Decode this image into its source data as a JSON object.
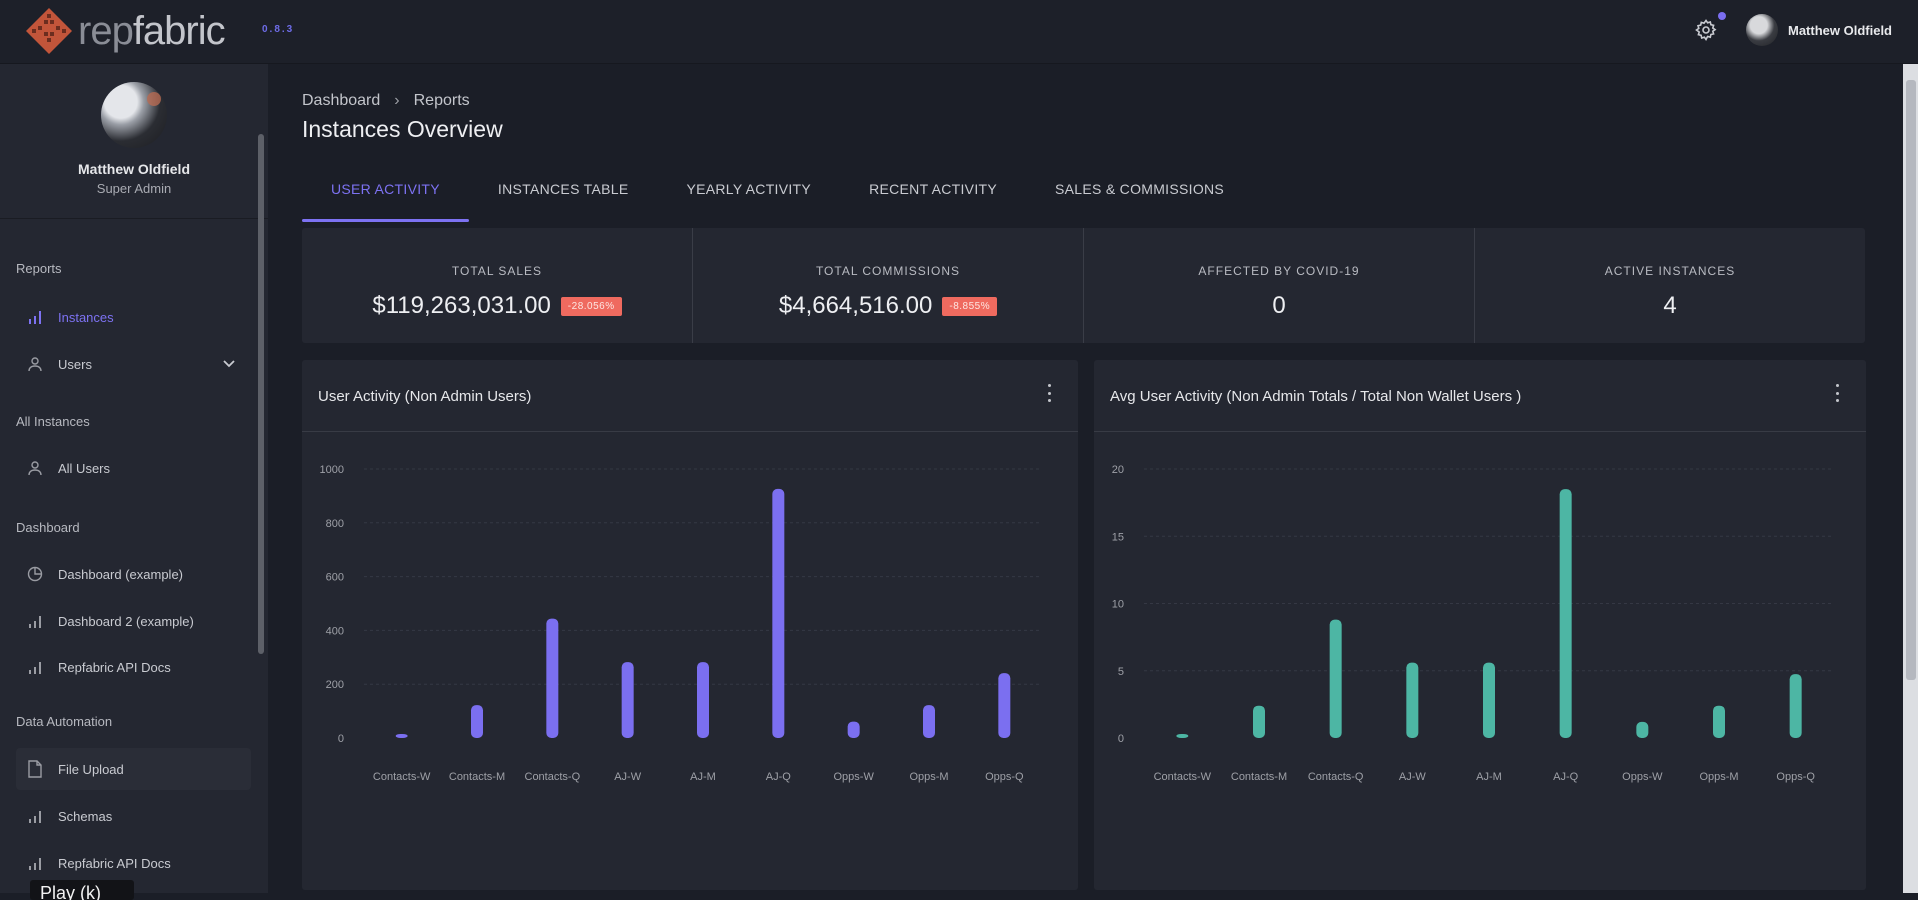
{
  "app": {
    "name_light": "rep",
    "name_bold": "fabric",
    "version": "0.8.3",
    "user_name": "Matthew Oldfield"
  },
  "sidebar": {
    "profile": {
      "name": "Matthew Oldfield",
      "role": "Super Admin"
    },
    "sections": [
      {
        "title": "Reports",
        "items": [
          {
            "label": "Instances",
            "icon": "bar-chart-icon",
            "active": true
          },
          {
            "label": "Users",
            "icon": "user-icon",
            "expandable": true
          }
        ]
      },
      {
        "title": "All Instances",
        "items": [
          {
            "label": "All Users",
            "icon": "user-icon"
          }
        ]
      },
      {
        "title": "Dashboard",
        "items": [
          {
            "label": "Dashboard (example)",
            "icon": "pie-chart-icon"
          },
          {
            "label": "Dashboard 2 (example)",
            "icon": "bar-chart-icon"
          },
          {
            "label": "Repfabric API Docs",
            "icon": "bar-chart-icon"
          }
        ]
      },
      {
        "title": "Data Automation",
        "items": [
          {
            "label": "File Upload",
            "icon": "file-icon",
            "hover": true
          },
          {
            "label": "Schemas",
            "icon": "bar-chart-icon"
          },
          {
            "label": "Repfabric API Docs",
            "icon": "bar-chart-icon"
          }
        ]
      }
    ]
  },
  "tooltip": "Play (k)",
  "breadcrumb": [
    "Dashboard",
    "Reports"
  ],
  "page_title": "Instances Overview",
  "tabs": [
    {
      "label": "USER ACTIVITY",
      "active": true
    },
    {
      "label": "INSTANCES TABLE"
    },
    {
      "label": "YEARLY ACTIVITY"
    },
    {
      "label": "RECENT ACTIVITY"
    },
    {
      "label": "SALES & COMMISSIONS"
    }
  ],
  "stats": [
    {
      "label": "TOTAL SALES",
      "value": "$119,263,031.00",
      "badge": "-28.056%"
    },
    {
      "label": "TOTAL COMMISSIONS",
      "value": "$4,664,516.00",
      "badge": "-8.855%"
    },
    {
      "label": "AFFECTED BY COVID-19",
      "value": "0"
    },
    {
      "label": "ACTIVE INSTANCES",
      "value": "4"
    }
  ],
  "colors": {
    "accent": "#7d72f2",
    "bar_purple": "#7b6ff0",
    "bar_teal": "#4db6a4",
    "badge_red": "#ef6a5f"
  },
  "chart_data": [
    {
      "type": "bar",
      "title": "User Activity (Non Admin Users)",
      "categories": [
        "Contacts-W",
        "Contacts-M",
        "Contacts-Q",
        "AJ-W",
        "AJ-M",
        "AJ-Q",
        "Opps-W",
        "Opps-M",
        "Opps-Q"
      ],
      "values": [
        15,
        122,
        444,
        282,
        282,
        926,
        61,
        122,
        241
      ],
      "yticks": [
        0,
        200,
        400,
        600,
        800,
        1000
      ],
      "ylim": [
        0,
        1000
      ],
      "xlabel": "",
      "ylabel": "",
      "grid": true,
      "color": "#7b6ff0"
    },
    {
      "type": "bar",
      "title": "Avg User Activity (Non Admin Totals / Total Non Wallet Users )",
      "categories": [
        "Contacts-W",
        "Contacts-M",
        "Contacts-Q",
        "AJ-W",
        "AJ-M",
        "AJ-Q",
        "Opps-W",
        "Opps-M",
        "Opps-Q"
      ],
      "values": [
        0.3,
        2.4,
        8.8,
        5.6,
        5.6,
        18.5,
        1.2,
        2.4,
        4.75
      ],
      "yticks": [
        0,
        5,
        10,
        15,
        20
      ],
      "ylim": [
        0,
        20
      ],
      "xlabel": "",
      "ylabel": "",
      "grid": true,
      "color": "#4db6a4"
    }
  ]
}
